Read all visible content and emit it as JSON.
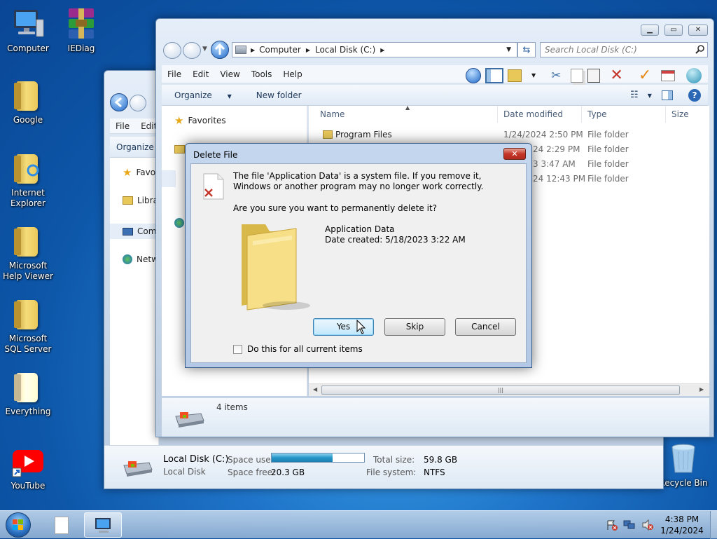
{
  "desktop": {
    "icons": [
      {
        "label": "Computer"
      },
      {
        "label": "IEDiag"
      },
      {
        "label": "Google"
      },
      {
        "label": "Internet Explorer"
      },
      {
        "label": "Microsoft Help Viewer"
      },
      {
        "label": "Microsoft SQL Server"
      },
      {
        "label": "Everything"
      },
      {
        "label": "YouTube"
      },
      {
        "label": "Recycle Bin"
      }
    ]
  },
  "back_window": {
    "menu": [
      "File",
      "Edit"
    ],
    "cmd": [
      "Organize"
    ],
    "nav": [
      "Favo",
      "Libra",
      "Com",
      "Netw"
    ],
    "details": {
      "drive_name": "Local Disk (C:)",
      "drive_type": "Local Disk",
      "space_used_label": "Space used:",
      "space_used_fraction": 0.66,
      "space_free_label": "Space free:",
      "space_free_value": "20.3 GB",
      "total_size_label": "Total size:",
      "total_size_value": "59.8 GB",
      "file_system_label": "File system:",
      "file_system_value": "NTFS"
    }
  },
  "front_window": {
    "address": {
      "crumbs": [
        "Computer",
        "Local Disk (C:)"
      ]
    },
    "search_placeholder": "Search Local Disk (C:)",
    "menu": [
      "File",
      "Edit",
      "View",
      "Tools",
      "Help"
    ],
    "cmd": {
      "organize": "Organize",
      "new_folder": "New folder"
    },
    "nav": {
      "favorites": "Favorites"
    },
    "columns": [
      "Name",
      "Date modified",
      "Type",
      "Size"
    ],
    "rows": [
      {
        "name": "Program Files",
        "date": "1/24/2024 2:50 PM",
        "type": "File folder"
      },
      {
        "name": "",
        "date": "24 2:29 PM",
        "type": "File folder"
      },
      {
        "name": "",
        "date": "3 3:47 AM",
        "type": "File folder"
      },
      {
        "name": "",
        "date": "24 12:43 PM",
        "type": "File folder"
      }
    ],
    "status": "4 items"
  },
  "dialog": {
    "title": "Delete File",
    "message": "The file 'Application Data' is a system file. If you remove it, Windows or another program may no longer work correctly.",
    "question": "Are you sure you want to permanently delete it?",
    "item_name": "Application Data",
    "item_date": "Date created: 5/18/2023 3:22 AM",
    "yes": "Yes",
    "skip": "Skip",
    "cancel": "Cancel",
    "checkbox_label": "Do this for all current items",
    "checkbox_checked": false
  },
  "taskbar": {
    "time": "4:38 PM",
    "date": "1/24/2024"
  },
  "colors": {
    "accent": "#1e68c9",
    "dialog_default_border": "#3c7fb1",
    "close_red": "#c4372a"
  }
}
